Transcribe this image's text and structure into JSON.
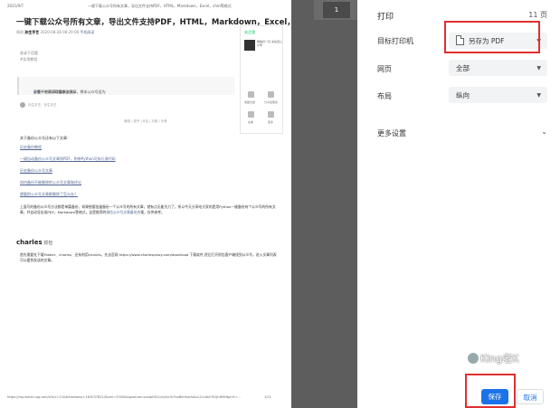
{
  "preview": {
    "page_badge": "1",
    "header_date": "2021/9/7",
    "header_title": "一键下载公众号所有文章，导出文件支持PDF，HTML，Markdown，Excel，chm等格式",
    "article_title": "一键下载公众号所有文章，导出文件支持PDF，HTML，Markdown，Excel，chm等格式",
    "meta_prefix": "原创",
    "meta_account": "孙生手艺",
    "meta_date": "2020-08-28 08:29:08",
    "meta_link": "手机阅读",
    "card": {
      "follow": "关注我",
      "desc": "微信扫一扫 关注该公众号",
      "icons": [
        "收藏文章",
        "分享给朋友",
        "在看",
        "更多"
      ]
    },
    "lead_line1": "收录于话题",
    "lead_line2": "#实用教程",
    "quote_text": "孙生手艺第167篇原创文章，将本公众号设为",
    "quote_highlight": "星标",
    "quote_tail": "，第一时间获取最新文章。",
    "author_line": "孙生手艺：孙生手艺",
    "centered_line": "微信 | 知乎 | B站 | 抖音 | 头条",
    "intro": "关于备份公众号还有以下文章：",
    "links": [
      "历史备份教程",
      "一键自动备份公众号文章到PDF，附带Python可执行源代码",
      "历史备份公众号文章",
      "如何备份不被删除的公众号文章和评论",
      "想要把公众号文章都删除了怎么办？"
    ],
    "para1": "上面写的备份公众号方法都是单篇备份，如果想要批量备份一个公众号的所有文章，就有点无能为力了，所以今天分享给大家的是用Python一键备份有个公众号的所有文章，并自动导出成PDF，Markdown等格式，这是推荐的",
    "para1_highlight": "微信公众号文章备份",
    "para1_tail": "方案，仅供参考。",
    "section_heading": "charles",
    "section_sub": " 抓包",
    "para2": "首先需要先下载Fiddler、charles、还有利用charles，先去官网 https://www.charlesproxy.com/download 下载软件,然后打开抓包客户端找到公众号，进入文章列表可以看到发送的文章。",
    "footer_url": "https://mp.weixin.qq.com/s?src=11&timestamp=1630378224&ver=3305&signature=pxdpHSCum/XcrScYssBkHkdrAAlxL2c1bhkTKQhRMrNpmF=...",
    "footer_page": "1/11"
  },
  "settings": {
    "title": "打印",
    "pages_count": "11 页",
    "destination_label": "目标打印机",
    "destination_value": "另存为 PDF",
    "pages_label": "网页",
    "pages_value": "全部",
    "layout_label": "布局",
    "layout_value": "纵向",
    "more_label": "更多设置",
    "save_button": "保存",
    "cancel_button": "取消"
  },
  "watermark": "King老K"
}
